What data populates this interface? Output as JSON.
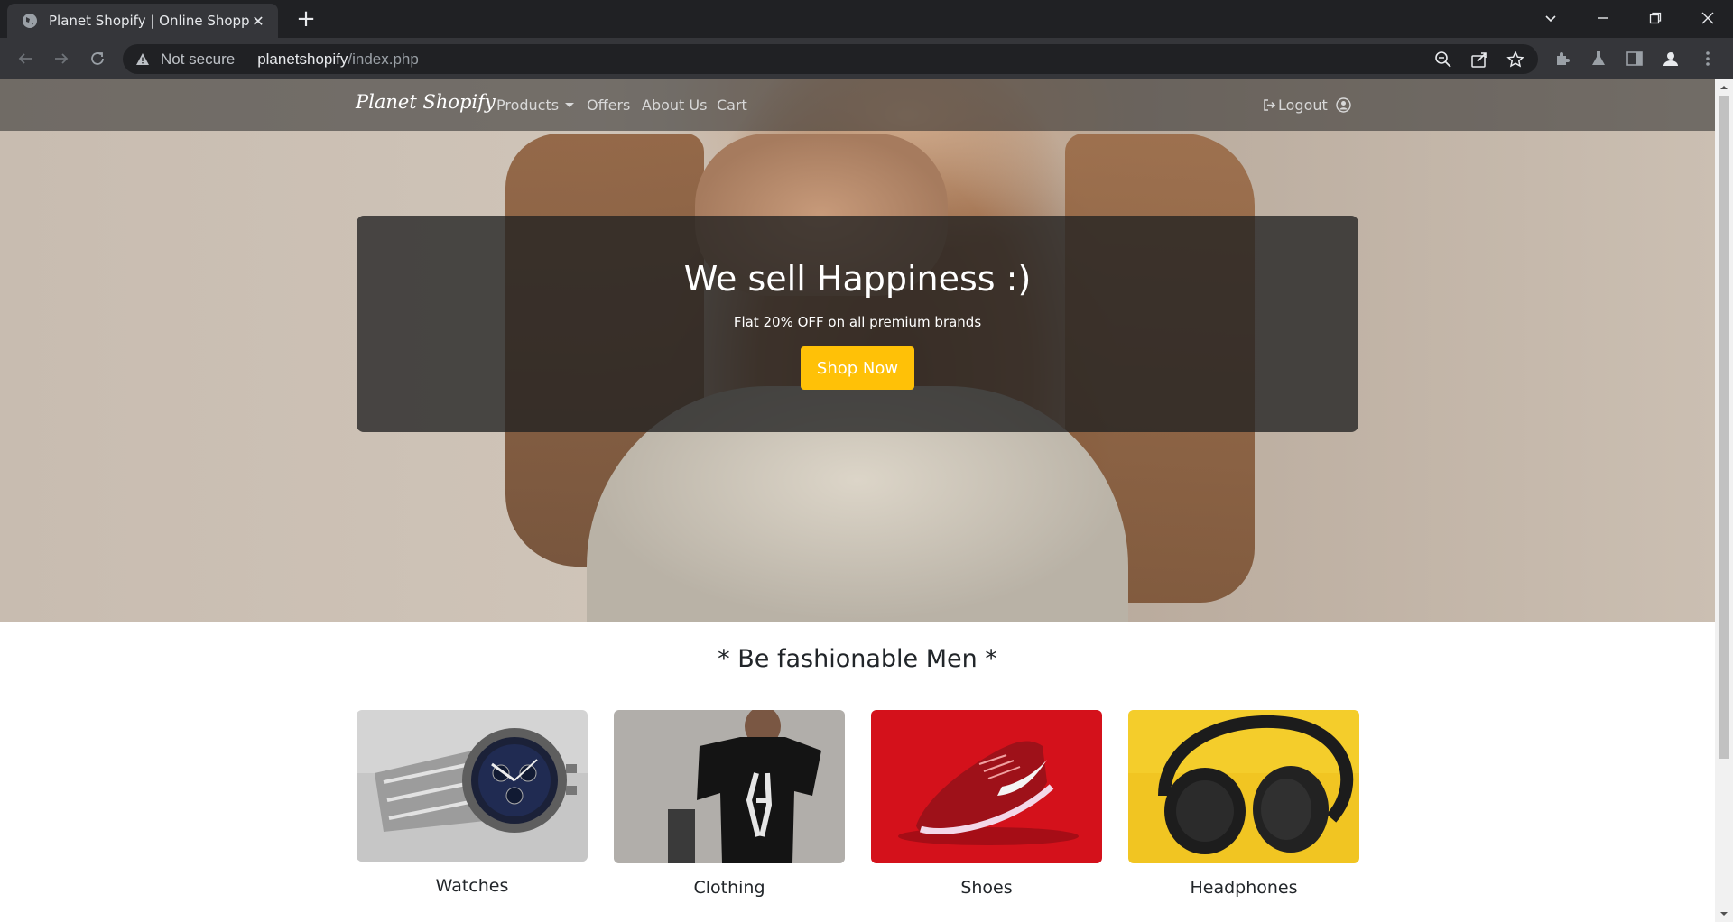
{
  "browser": {
    "tab_title": "Planet Shopify | Online Shopping",
    "not_secure": "Not secure",
    "url_host": "planetshopify",
    "url_path": "/index.php"
  },
  "nav": {
    "brand": "Planet Shopify",
    "links": [
      "Products",
      "Offers",
      "About Us",
      "Cart"
    ],
    "logout": "Logout"
  },
  "hero": {
    "title": "We sell Happiness :)",
    "subtitle": "Flat 20% OFF on all premium brands",
    "button": "Shop Now"
  },
  "section": {
    "title": "* Be fashionable Men *",
    "categories": [
      "Watches",
      "Clothing",
      "Shoes",
      "Headphones"
    ]
  },
  "colors": {
    "accent_button": "#ffc107",
    "browser_dark": "#202124",
    "browser_toolbar": "#35363a"
  }
}
